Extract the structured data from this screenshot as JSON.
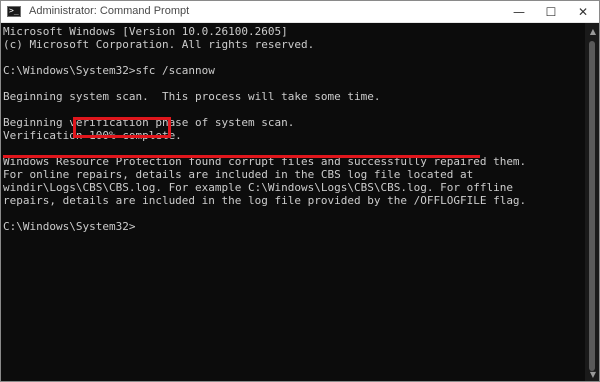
{
  "window": {
    "title": "Administrator: Command Prompt",
    "icon": "cmd-icon",
    "controls": {
      "minimize": "—",
      "maximize": "☐",
      "close": "✕"
    }
  },
  "console": {
    "lines": [
      "Microsoft Windows [Version 10.0.26100.2605]",
      "(c) Microsoft Corporation. All rights reserved.",
      "",
      "C:\\Windows\\System32>sfc /scannow",
      "",
      "Beginning system scan.  This process will take some time.",
      "",
      "Beginning verification phase of system scan.",
      "Verification 100% complete.",
      "",
      "Windows Resource Protection found corrupt files and successfully repaired them.",
      "For online repairs, details are included in the CBS log file located at",
      "windir\\Logs\\CBS\\CBS.log. For example C:\\Windows\\Logs\\CBS\\CBS.log. For offline",
      "repairs, details are included in the log file provided by the /OFFLOGFILE flag.",
      "",
      "C:\\Windows\\System32>"
    ]
  },
  "colors": {
    "annotation": "#e0161c",
    "console_bg": "#0c0c0c",
    "console_text": "#cccccc"
  }
}
